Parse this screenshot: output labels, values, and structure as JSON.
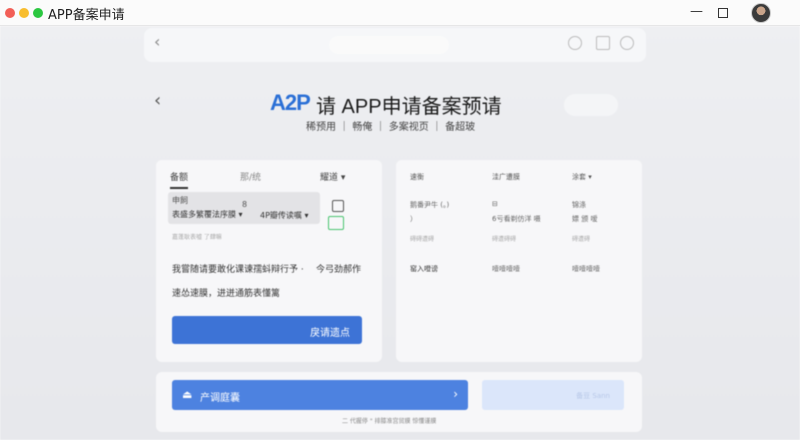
{
  "window": {
    "title": "APP备案申请",
    "minimize_glyph": "—",
    "colors": {
      "close": "#f25f57",
      "minimize": "#f8bd2e",
      "zoom": "#2bc740"
    }
  },
  "toolbar": {
    "back_glyph": "‹"
  },
  "header": {
    "back_glyph": "‹",
    "logo_text": "A2P",
    "title": "请 APP申请备案预请",
    "subnav": "稀预用 ｜ 畅俺 ｜ 多案视页 ｜ 备超玻"
  },
  "left_card": {
    "tabs": [
      "备额",
      "那/统",
      "耀道 ▾"
    ],
    "select": {
      "label": "申飼",
      "value": "表盛多繁覆法序膜 ▾",
      "option_b": "4P瓣传读嘱 ▾",
      "icon_label": "8",
      "note": "嘉蓬耿表嘘 了肆嘛"
    },
    "line1": "我嘗随请要敢化课谏孺蚪辩行予 ·",
    "line1_right": "今弓劲郝作",
    "line2": "速怂速膜，进迸通筋表懂篱",
    "primary_button": "戾请遗点"
  },
  "right_card": {
    "headers": [
      "速衡",
      "洼广遭膜",
      "涂套 ▾"
    ],
    "row1": [
      "鹅番尹牛 (。)",
      "⊟",
      "锦涤"
    ],
    "row1_sub": [
      "）",
      "6亏看剃仿洋 嗫",
      "嫖 颁 嗳"
    ],
    "row1_faint": [
      "碍碍遭碍",
      "碍遭碍碍",
      "碍遭碍"
    ],
    "row2": [
      "窑入噔谤",
      "噎噎噎噎",
      "噎噎噎噎"
    ]
  },
  "bottom": {
    "submit_icon": "⏏",
    "submit_label": "产调庭囊",
    "submit_arrow": "›",
    "ghost_label": "备豆  Sann",
    "foot_note": "二 代握停 \" 排膝准宫贸膜  惊懂谨膜"
  }
}
